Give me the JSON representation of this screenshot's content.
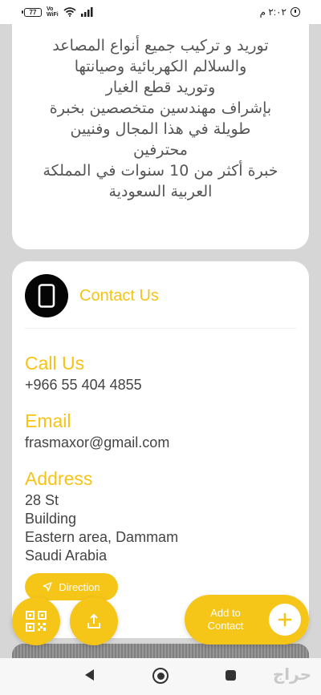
{
  "status_bar": {
    "battery": "77",
    "vowifi_top": "Vo",
    "vowifi_bottom": "WiFi",
    "time": "٢:٠٢ م"
  },
  "about": {
    "lines": [
      "توريد و تركيب جميع أنواع المصاعد",
      "والسلالم الكهربائية وصيانتها",
      "وتوريد قطع الغيار",
      "بإشراف مهندسين متخصصين بخبرة",
      "طويلة في هذا المجال وفنيين",
      "محترفين",
      "خبرة أكثر من 10 سنوات في المملكة",
      "العربية السعودية"
    ]
  },
  "contact": {
    "title": "Contact Us",
    "icon": "smartphone-icon",
    "call": {
      "label": "Call Us",
      "value": "+966 55 404 4855"
    },
    "email": {
      "label": "Email",
      "value": "frasmaxor@gmail.com"
    },
    "address": {
      "label": "Address",
      "lines": [
        "28 St",
        "Building",
        "Eastern area, Dammam",
        "Saudi Arabia"
      ]
    },
    "direction_label": "Direction"
  },
  "actions": {
    "qr_icon": "qr-code-icon",
    "share_icon": "share-icon",
    "add_contact_line1": "Add to",
    "add_contact_line2": "Contact"
  },
  "watermark": "حراج",
  "colors": {
    "accent": "#f5c518",
    "accent_text": "#f5c416",
    "background": "#d6d6d6",
    "card": "#ffffff",
    "icon_circle": "#050505"
  }
}
